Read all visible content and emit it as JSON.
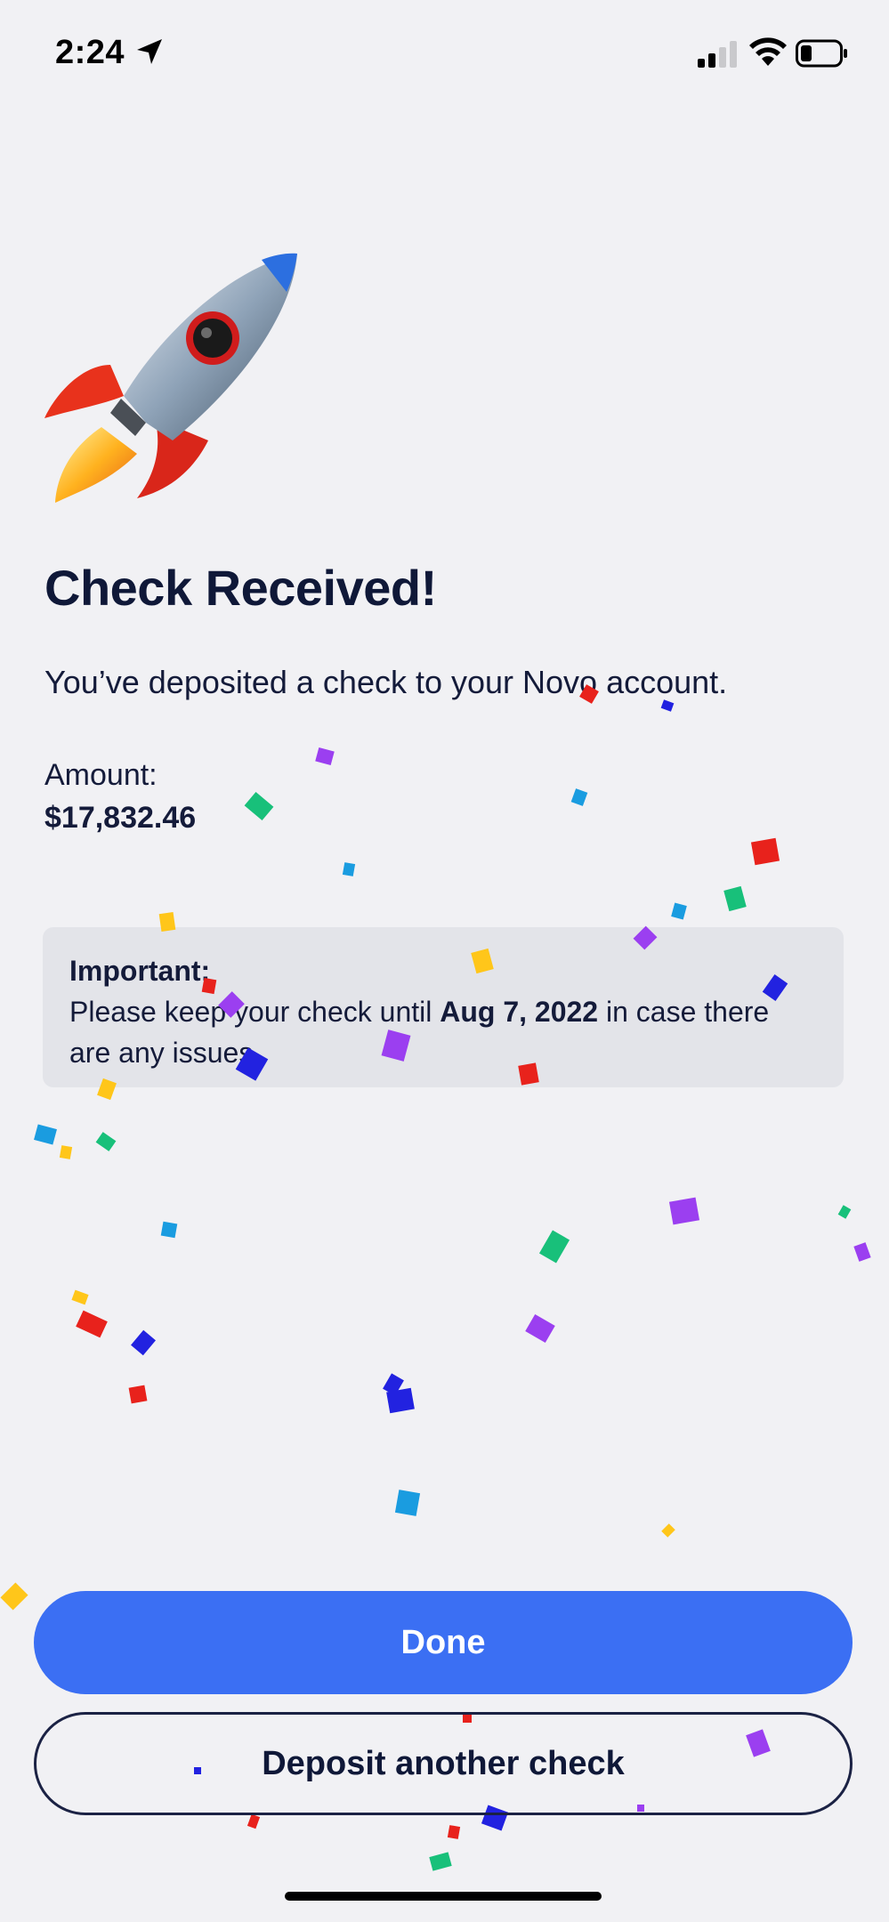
{
  "status_bar": {
    "time": "2:24"
  },
  "icons": {
    "location": "location-arrow-icon",
    "signal": "cellular-signal-icon",
    "wifi": "wifi-icon",
    "battery": "battery-icon",
    "rocket": "rocket-icon"
  },
  "main": {
    "title": "Check Received!",
    "subtitle": "You’ve deposited a check to your Novo account.",
    "amount_label": "Amount:",
    "amount_value": "$17,832.46"
  },
  "notice": {
    "title": "Important:",
    "body_before": "Please keep your check until ",
    "date": "Aug 7, 2022",
    "body_after": " in case there are any issues."
  },
  "actions": {
    "done_label": "Done",
    "deposit_label": "Deposit another check"
  },
  "colors": {
    "primary": "#3b6ff3",
    "text": "#0f1838",
    "background": "#f1f1f4"
  }
}
